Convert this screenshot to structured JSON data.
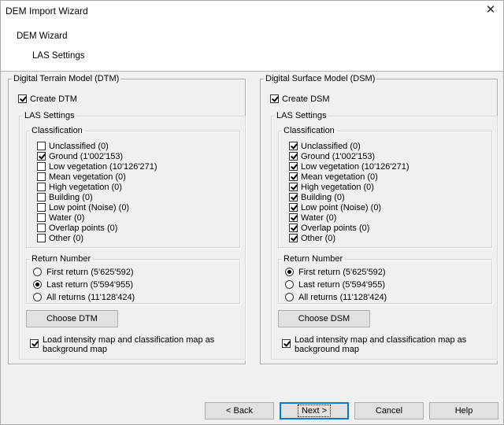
{
  "window": {
    "title": "DEM Import Wizard"
  },
  "header": {
    "title": "DEM Wizard",
    "subtitle": "LAS Settings"
  },
  "dtm": {
    "group_label": "Digital Terrain Model (DTM)",
    "create_label": "Create DTM",
    "create_checked": true,
    "las_label": "LAS Settings",
    "classification_label": "Classification",
    "classes": [
      {
        "label": "Unclassified  (0)",
        "checked": false
      },
      {
        "label": "Ground (1'002'153)",
        "checked": true
      },
      {
        "label": "Low vegetation (10'126'271)",
        "checked": false
      },
      {
        "label": "Mean vegetation (0)",
        "checked": false
      },
      {
        "label": "High vegetation (0)",
        "checked": false
      },
      {
        "label": "Building (0)",
        "checked": false
      },
      {
        "label": "Low point (Noise) (0)",
        "checked": false
      },
      {
        "label": "Water (0)",
        "checked": false
      },
      {
        "label": "Overlap points (0)",
        "checked": false
      },
      {
        "label": "Other (0)",
        "checked": false
      }
    ],
    "return_label": "Return Number",
    "returns": [
      {
        "label": "First return (5'625'592)",
        "checked": false
      },
      {
        "label": "Last return (5'594'955)",
        "checked": true
      },
      {
        "label": "All returns (11'128'424)",
        "checked": false
      }
    ],
    "choose_button": "Choose DTM",
    "load_map_label": "Load intensity map and classification map as background map",
    "load_map_checked": true
  },
  "dsm": {
    "group_label": "Digital Surface Model (DSM)",
    "create_label": "Create DSM",
    "create_checked": true,
    "las_label": "LAS Settings",
    "classification_label": "Classification",
    "classes": [
      {
        "label": "Unclassified  (0)",
        "checked": true
      },
      {
        "label": "Ground (1'002'153)",
        "checked": true
      },
      {
        "label": "Low vegetation (10'126'271)",
        "checked": true
      },
      {
        "label": "Mean vegetation (0)",
        "checked": true
      },
      {
        "label": "High vegetation (0)",
        "checked": true
      },
      {
        "label": "Building (0)",
        "checked": true
      },
      {
        "label": "Low point (Noise) (0)",
        "checked": true
      },
      {
        "label": "Water (0)",
        "checked": true
      },
      {
        "label": "Overlap points (0)",
        "checked": true
      },
      {
        "label": "Other (0)",
        "checked": true
      }
    ],
    "return_label": "Return Number",
    "returns": [
      {
        "label": "First return (5'625'592)",
        "checked": true
      },
      {
        "label": "Last return (5'594'955)",
        "checked": false
      },
      {
        "label": "All returns (11'128'424)",
        "checked": false
      }
    ],
    "choose_button": "Choose DSM",
    "load_map_label": "Load intensity map and classification map as background map",
    "load_map_checked": true
  },
  "footer": {
    "back": "< Back",
    "next": "Next >",
    "cancel": "Cancel",
    "help": "Help"
  },
  "icons": {
    "close": "close-icon"
  }
}
